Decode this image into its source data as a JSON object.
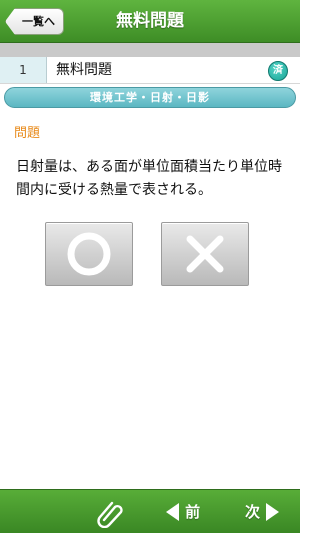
{
  "header": {
    "back_label": "一覧へ",
    "title": "無料問題"
  },
  "question": {
    "number": "1",
    "title": "無料問題",
    "status_badge": "済",
    "category": "環境工学・日射・日影",
    "section_label": "問題",
    "text": "日射量は、ある面が単位面積当たり単位時間内に受ける熱量で表される。"
  },
  "answers": {
    "true_icon": "circle-icon",
    "false_icon": "cross-icon"
  },
  "footer": {
    "clip_icon": "paperclip-icon",
    "prev_label": "前",
    "next_label": "次"
  },
  "colors": {
    "header_green": "#4a9d2f",
    "category_teal": "#6cc1cb",
    "section_orange": "#e88a1a",
    "badge_teal": "#19a496"
  }
}
